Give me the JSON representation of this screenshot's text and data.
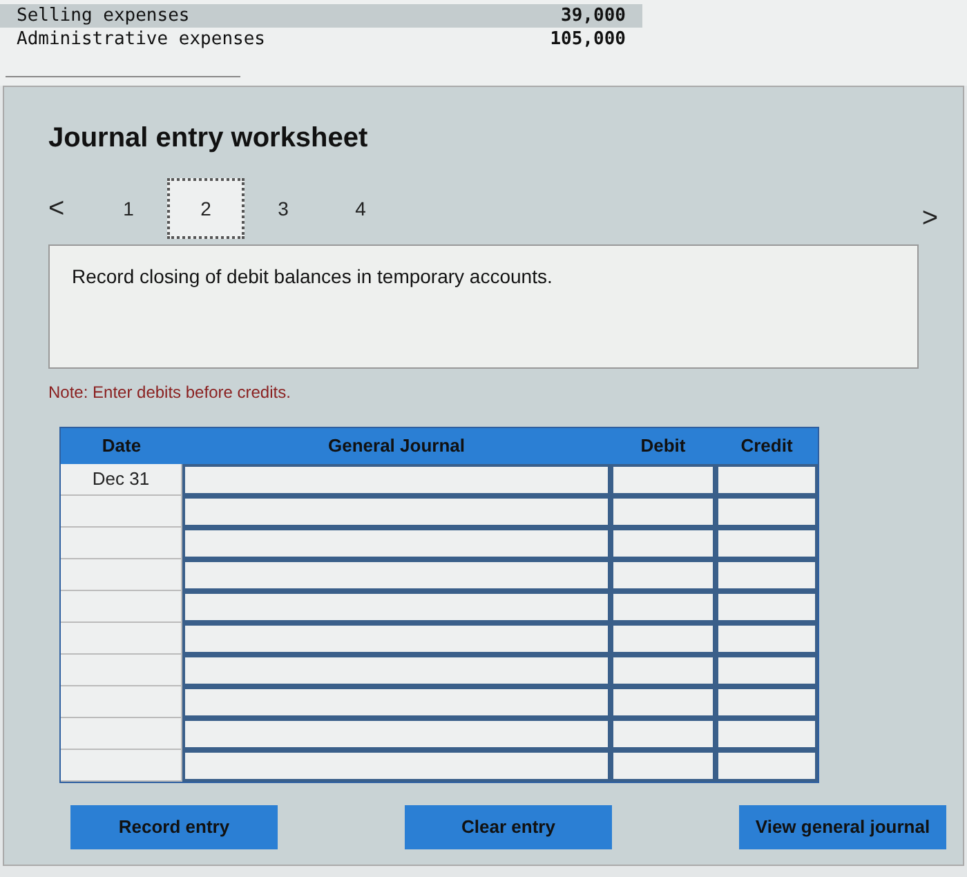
{
  "statement": [
    {
      "label": "Selling expenses",
      "amount": "39,000",
      "highlighted": true
    },
    {
      "label": "Administrative expenses",
      "amount": "105,000",
      "highlighted": false
    }
  ],
  "worksheet": {
    "title": "Journal entry worksheet",
    "prev": "<",
    "next": ">",
    "tabs": [
      {
        "label": "1",
        "selected": false
      },
      {
        "label": "2",
        "selected": true
      },
      {
        "label": "3",
        "selected": false
      },
      {
        "label": "4",
        "selected": false
      }
    ],
    "instruction": "Record closing of debit balances in temporary accounts.",
    "note": "Note: Enter debits before credits.",
    "table": {
      "columns": [
        "Date",
        "General Journal",
        "Debit",
        "Credit"
      ],
      "rows": [
        {
          "date": "Dec 31"
        },
        {},
        {},
        {},
        {},
        {},
        {},
        {},
        {},
        {}
      ]
    },
    "buttons": [
      "Record entry",
      "Clear entry",
      "View general journal"
    ]
  }
}
